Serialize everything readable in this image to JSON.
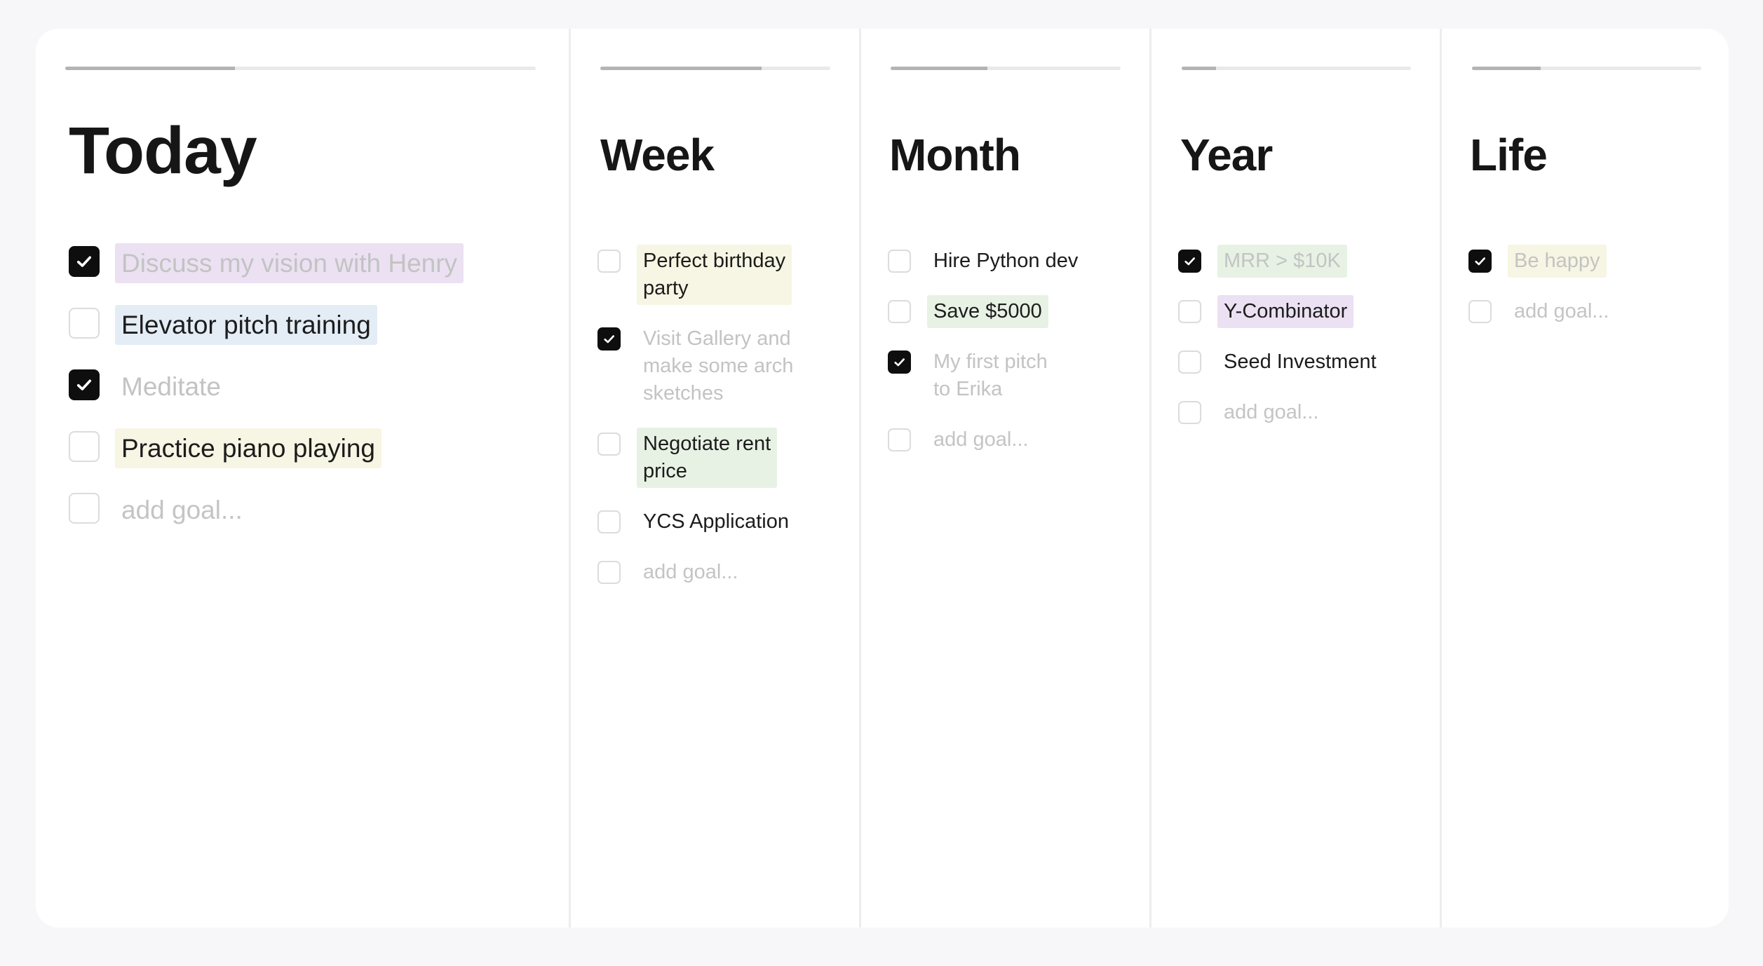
{
  "columns": {
    "today": {
      "title": "Today",
      "progress": 0.36,
      "goals": [
        {
          "text": "Discuss my vision with Henry",
          "done": true,
          "color": "#ebe1f2"
        },
        {
          "text": "Elevator pitch training",
          "done": false,
          "color": "#e4edf6"
        },
        {
          "text": "Meditate",
          "done": true,
          "color": null
        },
        {
          "text": "Practice piano playing",
          "done": false,
          "color": "#f7f5e3"
        }
      ],
      "add_placeholder": "add goal..."
    },
    "week": {
      "title": "Week",
      "progress": 0.7,
      "goals": [
        {
          "text": "Perfect birthday\nparty",
          "done": false,
          "color": "#f7f5e3"
        },
        {
          "text": "Visit Gallery and\nmake some arch\nsketches",
          "done": true,
          "color": null
        },
        {
          "text": "Negotiate rent\nprice",
          "done": false,
          "color": "#e7f2e4"
        },
        {
          "text": "YCS Application",
          "done": false,
          "color": null
        }
      ],
      "add_placeholder": "add goal..."
    },
    "month": {
      "title": "Month",
      "progress": 0.42,
      "goals": [
        {
          "text": "Hire Python dev",
          "done": false,
          "color": null
        },
        {
          "text": "Save $5000",
          "done": false,
          "color": "#e7f2e4"
        },
        {
          "text": "My first pitch\nto Erika",
          "done": true,
          "color": null
        }
      ],
      "add_placeholder": "add goal..."
    },
    "year": {
      "title": "Year",
      "progress": 0.15,
      "goals": [
        {
          "text": "MRR > $10K",
          "done": true,
          "color": "#e7f2e4"
        },
        {
          "text": "Y-Combinator",
          "done": false,
          "color": "#ebe1f2"
        },
        {
          "text": "Seed Investment",
          "done": false,
          "color": null
        }
      ],
      "add_placeholder": "add goal..."
    },
    "life": {
      "title": "Life",
      "progress": 0.3,
      "goals": [
        {
          "text": "Be happy",
          "done": true,
          "color": "#f7f5e3"
        }
      ],
      "add_placeholder": "add goal..."
    }
  }
}
